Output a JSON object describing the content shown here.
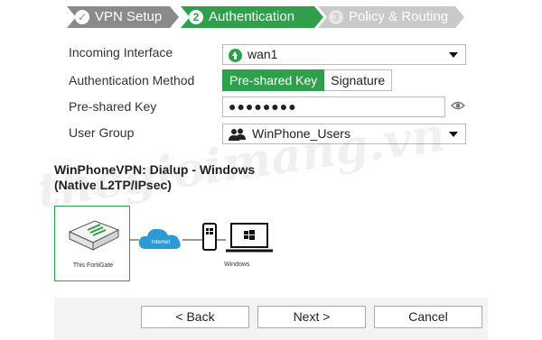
{
  "wizard": {
    "steps": [
      {
        "label": "VPN Setup",
        "marker": "✓"
      },
      {
        "label": "Authentication",
        "marker": "2"
      },
      {
        "label": "Policy & Routing",
        "marker": "3"
      }
    ]
  },
  "form": {
    "incoming_interface": {
      "label": "Incoming Interface",
      "value": "wan1"
    },
    "auth_method": {
      "label": "Authentication Method",
      "options": [
        "Pre-shared Key",
        "Signature"
      ],
      "selected": "Pre-shared Key"
    },
    "preshared_key": {
      "label": "Pre-shared Key",
      "value": "●●●●●●●●"
    },
    "user_group": {
      "label": "User Group",
      "value": "WinPhone_Users"
    }
  },
  "summary": {
    "title_line1": "WinPhoneVPN: Dialup - Windows",
    "title_line2": "(Native L2TP/IPsec)"
  },
  "diagram": {
    "fortigate_label": "This FortiGate",
    "cloud_label": "Internet",
    "client_label": "Windows"
  },
  "watermark": "thegioimang.vn",
  "buttons": {
    "back": "< Back",
    "next": "Next >",
    "cancel": "Cancel"
  },
  "colors": {
    "accent": "#2e9f4a",
    "step_done": "#8a8a8a",
    "step_pending": "#c9c9c9",
    "cloud": "#2b9ad6"
  }
}
